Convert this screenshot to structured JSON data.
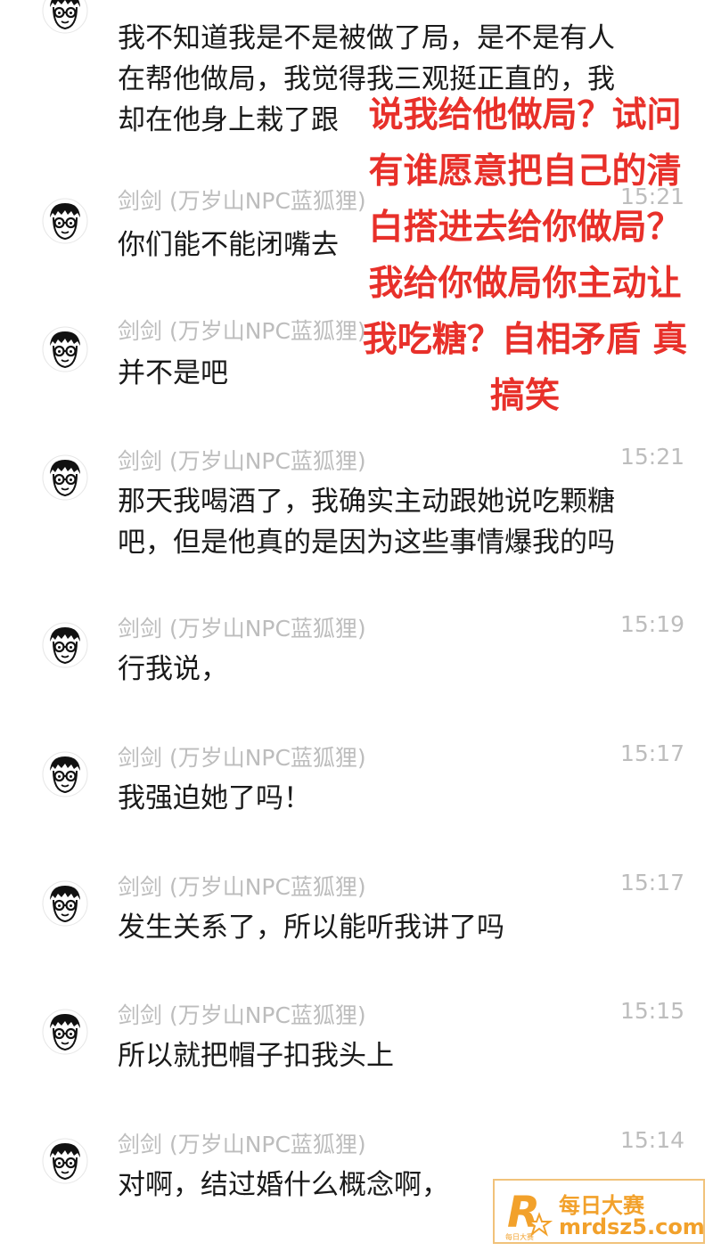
{
  "colors": {
    "sender_text": "#bdbdbd",
    "message_text": "#1a1a1a",
    "overlay_text": "#e8302a",
    "watermark_orange": "#f2a12b",
    "watermark_border": "#f1c27a"
  },
  "messages": [
    {
      "avatar_icon": "cartoon-boy-glasses-avatar",
      "sender": "",
      "time": "",
      "text": "我不知道我是不是被做了局，是不是有人\n在帮他做局，我觉得我三观挺正直的，我\n却在他身上栽了跟"
    },
    {
      "avatar_icon": "cartoon-boy-glasses-avatar",
      "sender": "剑剑 (万岁山NPC蓝狐狸)",
      "time": "15:21",
      "text": "你们能不能闭嘴去"
    },
    {
      "avatar_icon": "cartoon-boy-glasses-avatar",
      "sender": "剑剑 (万岁山NPC蓝狐狸)",
      "time": "",
      "text": "并不是吧"
    },
    {
      "avatar_icon": "cartoon-boy-glasses-avatar",
      "sender": "剑剑 (万岁山NPC蓝狐狸)",
      "time": "15:21",
      "text": "那天我喝酒了，我确实主动跟她说吃颗糖\n吧，但是他真的是因为这些事情爆我的吗"
    },
    {
      "avatar_icon": "cartoon-boy-glasses-avatar",
      "sender": "剑剑 (万岁山NPC蓝狐狸)",
      "time": "15:19",
      "text": "行我说，"
    },
    {
      "avatar_icon": "cartoon-boy-glasses-avatar",
      "sender": "剑剑 (万岁山NPC蓝狐狸)",
      "time": "15:17",
      "text": "我强迫她了吗！"
    },
    {
      "avatar_icon": "cartoon-boy-glasses-avatar",
      "sender": "剑剑 (万岁山NPC蓝狐狸)",
      "time": "15:17",
      "text": "发生关系了，所以能听我讲了吗"
    },
    {
      "avatar_icon": "cartoon-boy-glasses-avatar",
      "sender": "剑剑 (万岁山NPC蓝狐狸)",
      "time": "15:15",
      "text": "所以就把帽子扣我头上"
    },
    {
      "avatar_icon": "cartoon-boy-glasses-avatar",
      "sender": "剑剑 (万岁山NPC蓝狐狸)",
      "time": "15:14",
      "text": "对啊，结过婚什么概念啊，"
    }
  ],
  "overlay": {
    "text": "说我给他做局？试问\n有谁愿意把自己的清\n白搭进去给你做局？\n我给你做局你主动让\n我吃糖？自相矛盾 真\n搞笑"
  },
  "watermark": {
    "logo_icon": "r-star-logo-icon",
    "logo_caption": "每日大赛",
    "title": "每日大赛",
    "url": "mrdsz5.com"
  }
}
